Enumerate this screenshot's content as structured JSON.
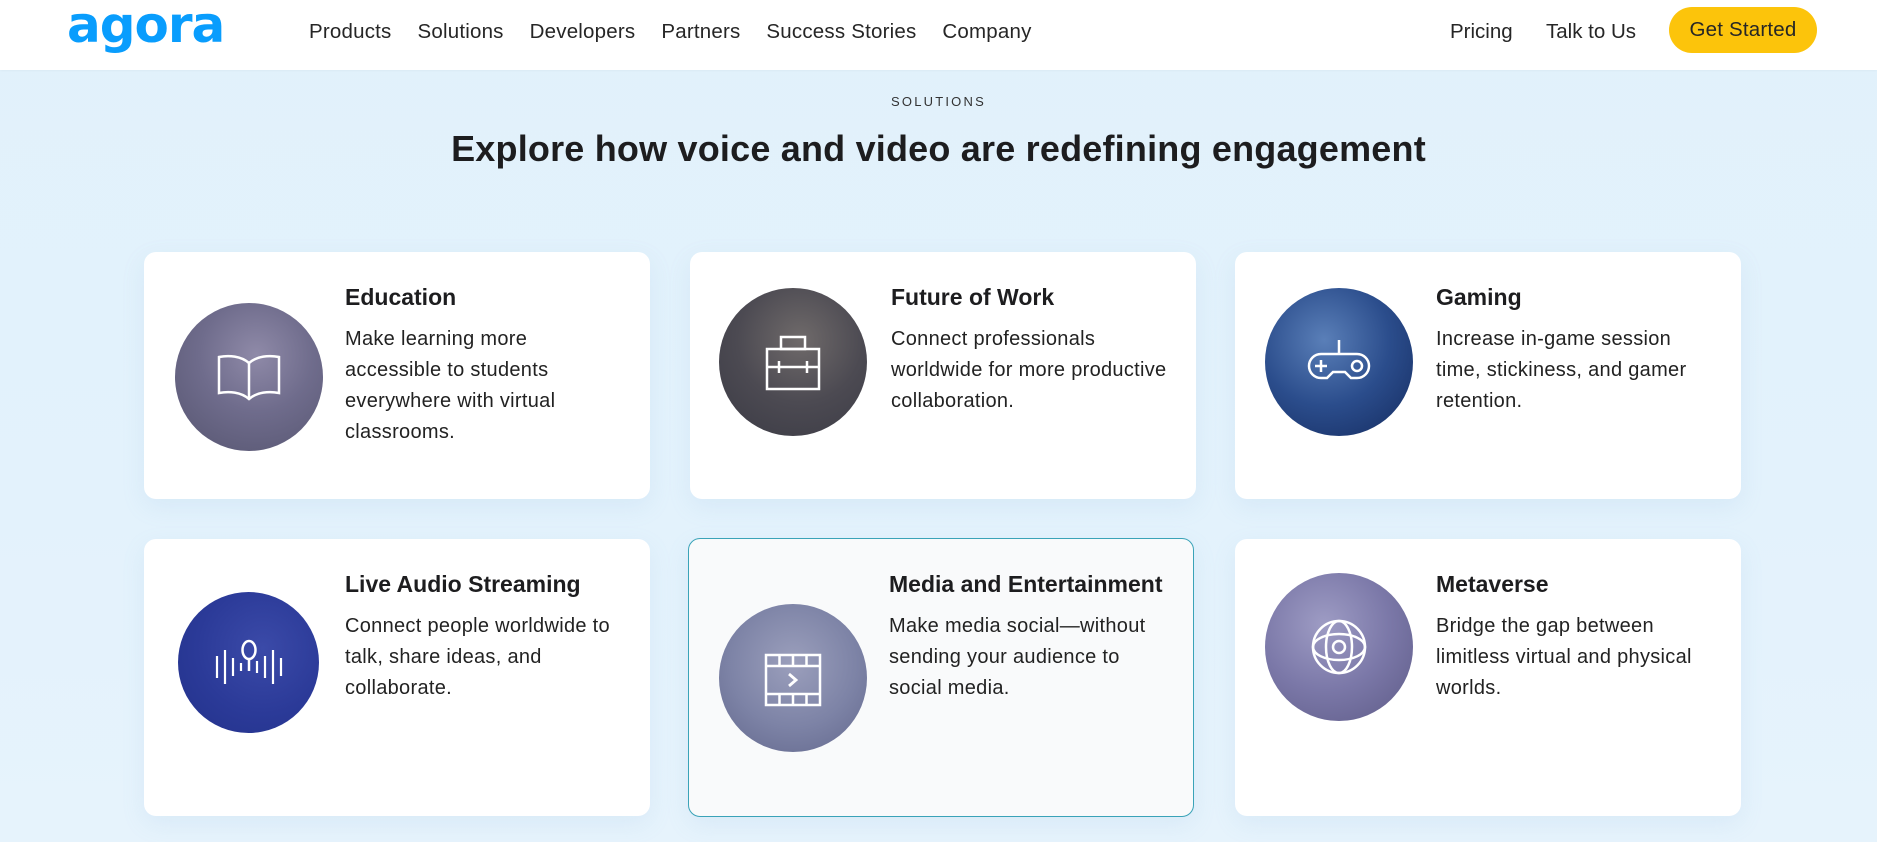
{
  "header": {
    "logo": "agora",
    "nav": [
      "Products",
      "Solutions",
      "Developers",
      "Partners",
      "Success Stories",
      "Company"
    ],
    "pricing": "Pricing",
    "talk": "Talk to Us",
    "cta": "Get Started"
  },
  "section": {
    "eyebrow": "SOLUTIONS",
    "headline_regular": "Explore how voice and video are ",
    "headline_bold": "redefining engagement"
  },
  "cards": [
    {
      "title": "Education",
      "description": "Make learning more accessible to students everywhere with virtual classrooms.",
      "icon": "book-icon"
    },
    {
      "title": "Future of Work",
      "description": "Connect professionals worldwide for more productive collaboration.",
      "icon": "briefcase-icon"
    },
    {
      "title": "Gaming",
      "description": "Increase in-game session time, stickiness, and gamer retention.",
      "icon": "gamepad-icon"
    },
    {
      "title": "Live Audio Streaming",
      "description": "Connect people worldwide to talk, share ideas, and collaborate.",
      "icon": "microphone-waveform-icon"
    },
    {
      "title": "Media and Entertainment",
      "description": "Make media social—without sending your audience to social media.",
      "icon": "film-play-icon",
      "active": true
    },
    {
      "title": "Metaverse",
      "description": "Bridge the gap between limitless virtual and physical worlds.",
      "icon": "orbit-globe-icon"
    }
  ],
  "colors": {
    "brand_blue": "#099dfd",
    "cta_yellow": "#fcc40b",
    "active_border": "#3aa3b8",
    "background": "#e2f1fb"
  }
}
